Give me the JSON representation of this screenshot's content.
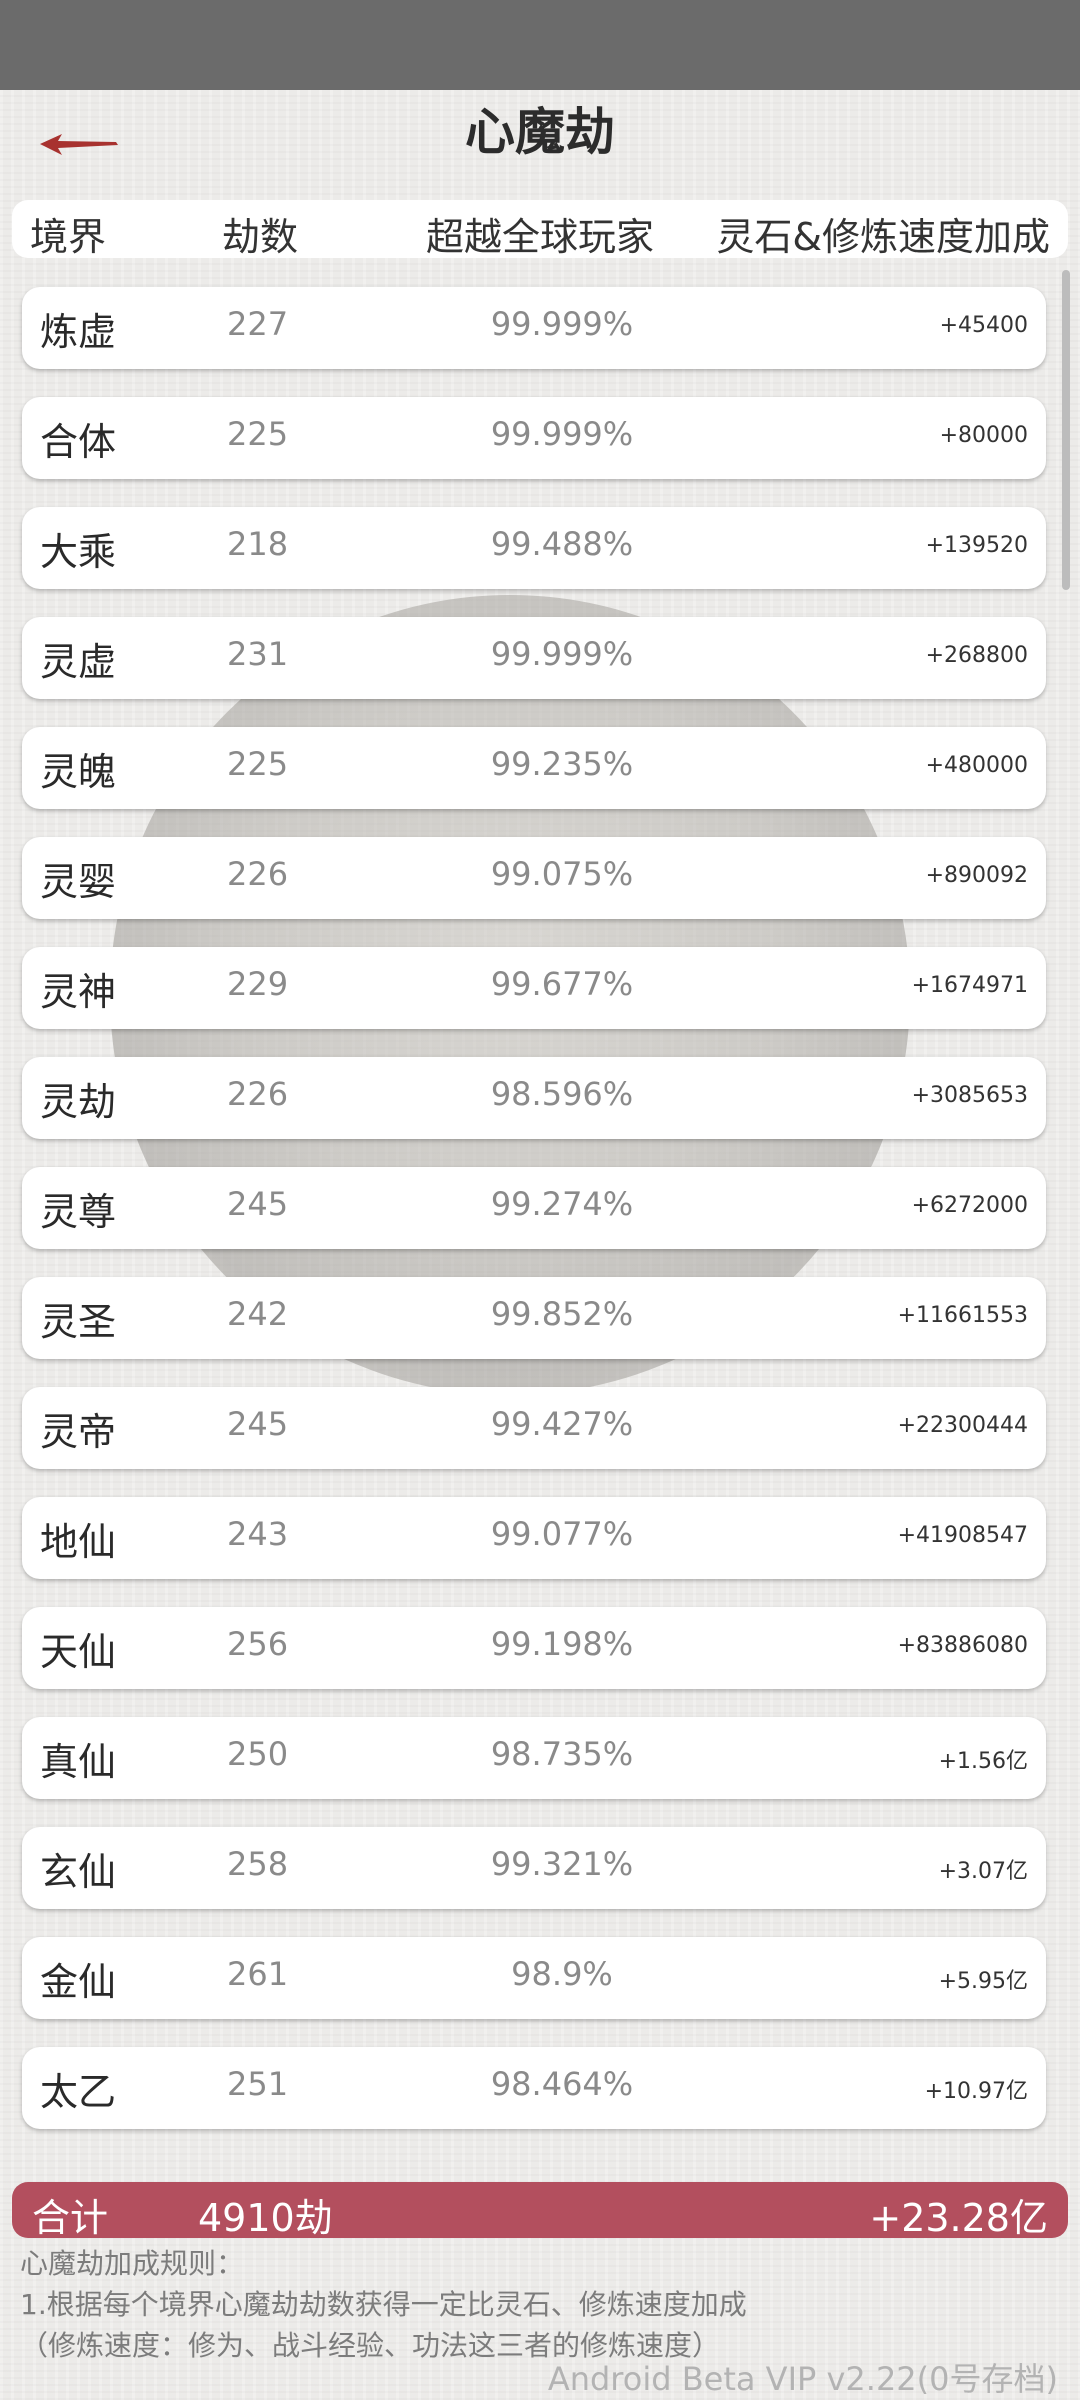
{
  "title": "心魔劫",
  "header": {
    "col_realm": "境界",
    "col_count": "劫数",
    "col_percent": "超越全球玩家",
    "col_bonus": "灵石&修炼速度加成"
  },
  "rows": [
    {
      "realm": "炼虚",
      "count": "227",
      "percent": "99.999%",
      "bonus": "+45400"
    },
    {
      "realm": "合体",
      "count": "225",
      "percent": "99.999%",
      "bonus": "+80000"
    },
    {
      "realm": "大乘",
      "count": "218",
      "percent": "99.488%",
      "bonus": "+139520"
    },
    {
      "realm": "灵虚",
      "count": "231",
      "percent": "99.999%",
      "bonus": "+268800"
    },
    {
      "realm": "灵魄",
      "count": "225",
      "percent": "99.235%",
      "bonus": "+480000"
    },
    {
      "realm": "灵婴",
      "count": "226",
      "percent": "99.075%",
      "bonus": "+890092"
    },
    {
      "realm": "灵神",
      "count": "229",
      "percent": "99.677%",
      "bonus": "+1674971"
    },
    {
      "realm": "灵劫",
      "count": "226",
      "percent": "98.596%",
      "bonus": "+3085653"
    },
    {
      "realm": "灵尊",
      "count": "245",
      "percent": "99.274%",
      "bonus": "+6272000"
    },
    {
      "realm": "灵圣",
      "count": "242",
      "percent": "99.852%",
      "bonus": "+11661553"
    },
    {
      "realm": "灵帝",
      "count": "245",
      "percent": "99.427%",
      "bonus": "+22300444"
    },
    {
      "realm": "地仙",
      "count": "243",
      "percent": "99.077%",
      "bonus": "+41908547"
    },
    {
      "realm": "天仙",
      "count": "256",
      "percent": "99.198%",
      "bonus": "+83886080"
    },
    {
      "realm": "真仙",
      "count": "250",
      "percent": "98.735%",
      "bonus": "+1.56亿"
    },
    {
      "realm": "玄仙",
      "count": "258",
      "percent": "99.321%",
      "bonus": "+3.07亿"
    },
    {
      "realm": "金仙",
      "count": "261",
      "percent": "98.9%",
      "bonus": "+5.95亿"
    },
    {
      "realm": "太乙",
      "count": "251",
      "percent": "98.464%",
      "bonus": "+10.97亿"
    }
  ],
  "total": {
    "label": "合计",
    "count": "4910劫",
    "bonus": "+23.28亿"
  },
  "rules": {
    "heading": "心魔劫加成规则：",
    "line1": "1.根据每个境界心魔劫劫数获得一定比灵石、修炼速度加成",
    "line2": "（修炼速度：修为、战斗经验、功法这三者的修炼速度）"
  },
  "version": "Android Beta VIP v2.22(0号存档)",
  "colors": {
    "accent": "#b34f5e",
    "back_arrow": "#a8322f"
  },
  "icons": {
    "back": "back-arrow-icon"
  }
}
